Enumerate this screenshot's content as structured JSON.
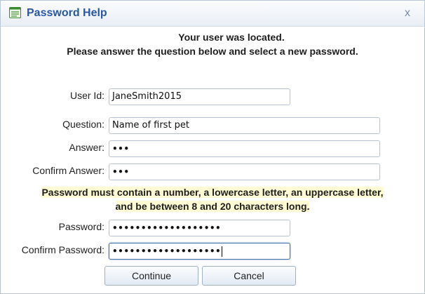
{
  "window": {
    "title": "Password Help",
    "close_glyph": "x",
    "icon": "form-document-icon"
  },
  "intro": {
    "line1": "Your user was located.",
    "line2": "Please answer the question below and select a new password."
  },
  "form": {
    "user_id_label": "User Id:",
    "user_id_value": "JaneSmith2015",
    "question_label": "Question:",
    "question_value": "Name of first pet",
    "answer_label": "Answer:",
    "answer_value": "•••",
    "confirm_answer_label": "Confirm Answer:",
    "confirm_answer_value": "•••",
    "password_rule_line1": "Password must contain a number, a lowercase letter, an uppercase letter,",
    "password_rule_line2": "and be between 8 and 20 characters long.",
    "password_label": "Password:",
    "password_value": "•••••••••••••••••••",
    "confirm_password_label": "Confirm Password:",
    "confirm_password_value": "•••••••••••••••••••"
  },
  "buttons": {
    "continue_label": "Continue",
    "cancel_label": "Cancel"
  },
  "colors": {
    "title_text": "#2a58a6",
    "highlight": "#fffbd4",
    "field_border": "#b8c4d2",
    "focus_border": "#4b6fa8"
  }
}
